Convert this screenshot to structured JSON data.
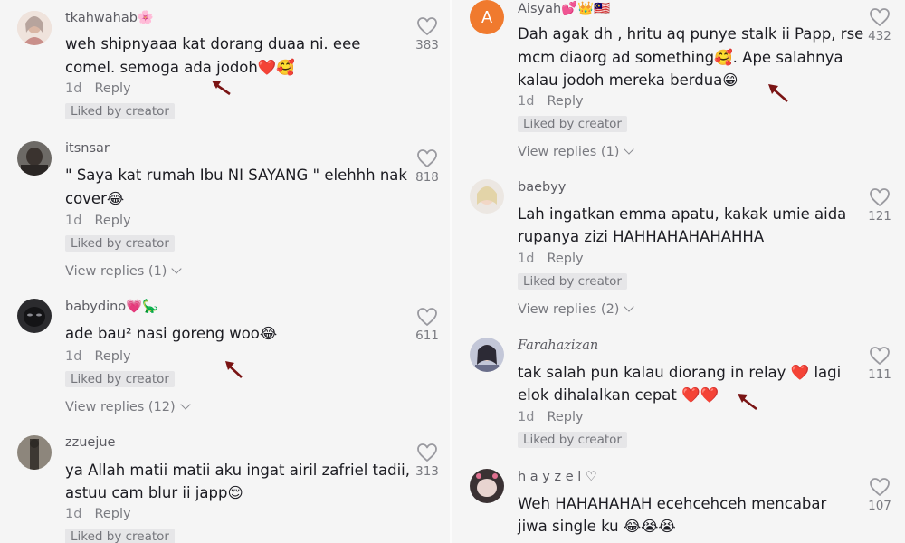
{
  "left": [
    {
      "username": "tkahwahab🌸",
      "lines": [
        "weh shipnyaaa kat dorang duaa ni. eee",
        "comel. semoga ada jodoh❤️🥰"
      ],
      "time": "1d",
      "reply": "Reply",
      "liked": "Liked by creator",
      "likes": "383",
      "view_replies": null
    },
    {
      "username": "itsnsar",
      "lines": [
        "\" Saya kat rumah Ibu NI SAYANG \" elehhh nak",
        "cover😂"
      ],
      "time": "1d",
      "reply": "Reply",
      "liked": "Liked by creator",
      "likes": "818",
      "view_replies": "View replies (1)"
    },
    {
      "username": "babydino💗🦕",
      "lines": [
        "ade bau² nasi goreng woo😂"
      ],
      "time": "1d",
      "reply": "Reply",
      "liked": "Liked by creator",
      "likes": "611",
      "view_replies": "View replies (12)"
    },
    {
      "username": "zzuejue",
      "lines": [
        "ya Allah matii matii aku ingat airil zafriel tadii,",
        "astuu cam blur ii japp😌"
      ],
      "time": "1d",
      "reply": "Reply",
      "liked": "Liked by creator",
      "likes": "313",
      "view_replies": null
    }
  ],
  "right": [
    {
      "username": "Aisyah💕👑🇲🇾",
      "avatar_letter": "A",
      "lines": [
        "Dah agak dh , hritu aq punye stalk ii Papp, rse",
        "mcm diaorg ad something🥰. Ape salahnya",
        "kalau jodoh mereka berdua😁"
      ],
      "time": "1d",
      "reply": "Reply",
      "liked": "Liked by creator",
      "likes": "432",
      "view_replies": "View replies (1)"
    },
    {
      "username": "baebyy",
      "lines": [
        "Lah ingatkan emma apatu, kakak umie aida",
        "rupanya zizi HAHHAHAHAHAHHA"
      ],
      "time": "1d",
      "reply": "Reply",
      "liked": "Liked by creator",
      "likes": "121",
      "view_replies": "View replies (2)"
    },
    {
      "username": "Farahazizan",
      "lines": [
        "tak salah pun kalau diorang in relay ❤️ lagi",
        "elok dihalalkan cepat ❤️❤️"
      ],
      "time": "1d",
      "reply": "Reply",
      "liked": "Liked by creator",
      "likes": "111",
      "view_replies": null
    },
    {
      "username": "h a y z e l ♡",
      "lines": [
        "Weh HAHAHAHAH ecehcehceh mencabar",
        "jiwa single ku 😂😭😭"
      ],
      "time": "",
      "reply": "",
      "liked": "",
      "likes": "107",
      "view_replies": null
    }
  ],
  "colors": {
    "arrow": "#7a1414",
    "heart_outline": "#9a9aa0",
    "avatar_a": "#f07a2e"
  },
  "icons": {
    "like": "heart-outline-icon",
    "annotation": "red-arrow-icon",
    "expand": "chevron-down-icon"
  }
}
